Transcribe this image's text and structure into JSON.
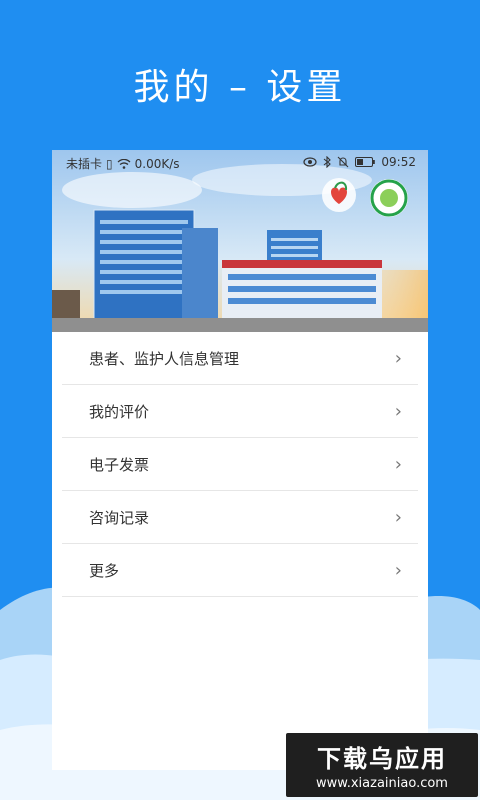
{
  "headline": "我的  –  设置",
  "status": {
    "carrier": "未插卡",
    "speed": "0.00K/s",
    "time": "09:52"
  },
  "menu": {
    "items": [
      {
        "label": "患者、监护人信息管理"
      },
      {
        "label": "我的评价"
      },
      {
        "label": "电子发票"
      },
      {
        "label": "咨询记录"
      },
      {
        "label": "更多"
      }
    ],
    "chevron": "›"
  },
  "watermark": {
    "line1": "下载乌应用",
    "line2": "www.xiazainiao.com"
  },
  "colors": {
    "background": "#1f8ef1",
    "accent": "#2a7fcd"
  },
  "icons": {
    "wifi": "wifi-icon",
    "bluetooth": "bluetooth-icon",
    "eye": "eye-icon",
    "mute": "bell-muted-icon",
    "battery": "battery-icon",
    "logo1": "hospital-logo-heart",
    "logo2": "hospital-logo-round"
  }
}
